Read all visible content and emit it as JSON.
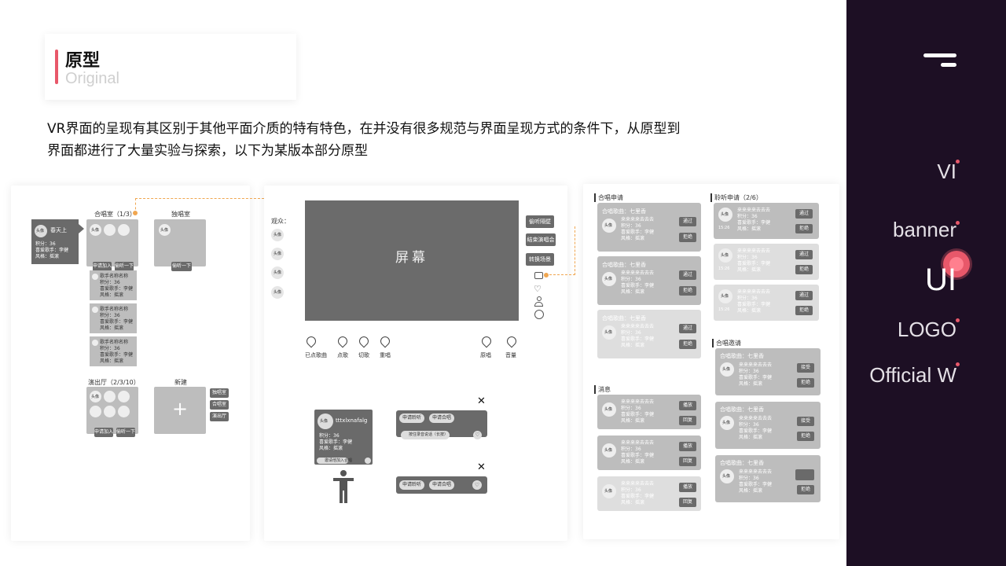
{
  "header": {
    "title_zh": "原型",
    "title_en": "Original",
    "intro_line1": "VR界面的呈现有其区别于其他平面介质的特有特色，在并没有很多规范与界面呈现方式的条件下，从原型到",
    "intro_line2": "界面都进行了大量实验与探索，以下为某版本部分原型"
  },
  "nav": {
    "items": [
      "VI",
      "banner",
      "UI",
      "LOGO",
      "Official W"
    ],
    "active": "UI"
  },
  "colors": {
    "accent": "#e8586a",
    "nav_bg": "#1d0f24",
    "proto_dark": "#6a6a6a",
    "proto_light": "#bdbdbd"
  },
  "p1": {
    "profile_name": "春天上",
    "avatar": "头像",
    "profile_lines": [
      "积分：36",
      "喜爱歌手：李健",
      "风格：摇滚"
    ],
    "chorus_room": "合唱室（1/3）",
    "solo_room": "独唱室",
    "apply_join": "申请加入",
    "listen": "偷听一下",
    "singer_label": "歌手名称名称",
    "singer_lines": [
      "积分：36",
      "喜爱歌手：李健",
      "风格：摇滚"
    ],
    "hall": "演出厅（2/3/10）",
    "new": "新建",
    "plus": "+",
    "side_buttons": [
      "独唱室",
      "合唱室",
      "演出厅"
    ]
  },
  "p2": {
    "audience": "观众：",
    "head": "头像",
    "screen": "屏幕",
    "right_buttons": [
      "偷听隔壁",
      "结束演唱会",
      "转换场景"
    ],
    "bottom_items": [
      "已点歌曲",
      "点歌",
      "切歌",
      "重唱",
      "原唱",
      "音量"
    ],
    "card_name": "tttxlxnafalg",
    "card_lines": [
      "积分：36",
      "喜爱歌手：李健",
      "风格：摇滚"
    ],
    "card_footer": "邀请他加入合唱",
    "mini_buttons": [
      "申请聆听",
      "申请合唱"
    ],
    "voice_label": "按住录音说话（长按）",
    "close": "✕"
  },
  "p3": {
    "chorus_apply": "合唱申请",
    "listen_apply": "聆听申请（2/6）",
    "messages": "消息",
    "chorus_invite": "合唱邀请",
    "song": "合唱歌曲：七里香",
    "user": "来来来来去去去",
    "head": "头像",
    "lines": [
      "积分：36",
      "喜爱歌手：李健",
      "风格：摇滚"
    ],
    "pass": "通过",
    "reject": "拒绝",
    "play": "播放",
    "reply": "回复",
    "accept": "接受",
    "time": "15:26"
  }
}
